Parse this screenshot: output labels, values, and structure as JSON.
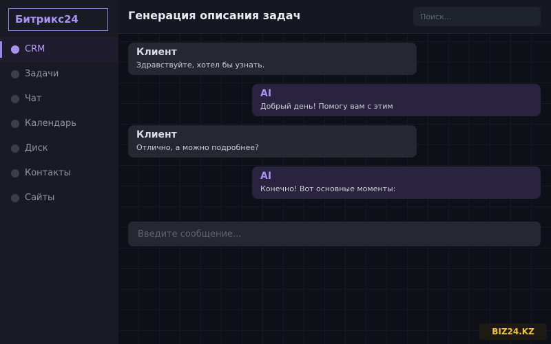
{
  "sidebar": {
    "logo": "Битрикс24",
    "items": [
      {
        "label": "CRM"
      },
      {
        "label": "Задачи"
      },
      {
        "label": "Чат"
      },
      {
        "label": "Календарь"
      },
      {
        "label": "Диск"
      },
      {
        "label": "Контакты"
      },
      {
        "label": "Сайты"
      }
    ]
  },
  "header": {
    "title": "Генерация описания задач",
    "search_placeholder": "Поиск..."
  },
  "chat": {
    "messages": [
      {
        "author": "Клиент",
        "text": "Здравствуйте, хотел бы узнать."
      },
      {
        "author": "AI",
        "text": "Добрый день! Помогу вам с этим"
      },
      {
        "author": "Клиент",
        "text": "Отлично, а можно подробнее?"
      },
      {
        "author": "AI",
        "text": "Конечно! Вот основные моменты:"
      }
    ],
    "input_placeholder": "Введите сообщение..."
  },
  "watermark": "BIZ24.KZ",
  "colors": {
    "accent": "#a993f0",
    "badge_text": "#f2c534"
  }
}
